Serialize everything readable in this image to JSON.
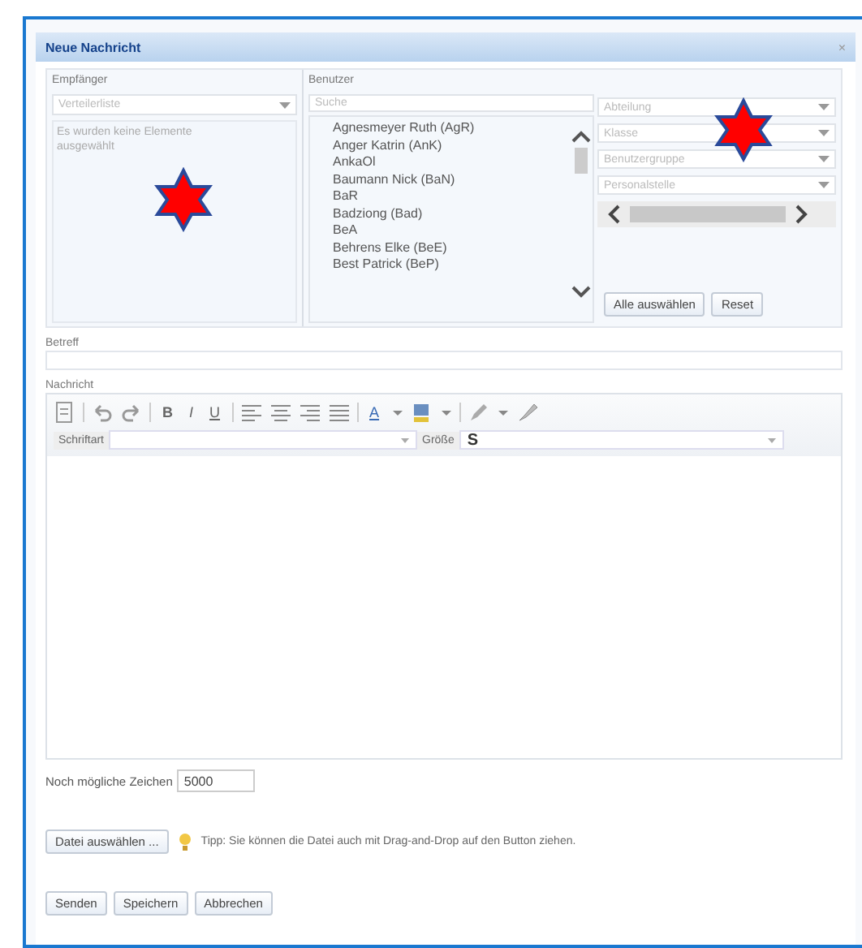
{
  "dialog": {
    "title": "Neue Nachricht",
    "close": "×"
  },
  "recipients": {
    "label": "Empfänger",
    "list_placeholder": "Verteilerliste",
    "empty_text": "Es wurden keine Elemente ausgewählt"
  },
  "users": {
    "label": "Benutzer",
    "search_placeholder": "Suche",
    "items": [
      "Agnesmeyer Ruth (AgR)",
      "Anger Katrin (AnK)",
      "AnkaOl",
      "Baumann Nick (BaN)",
      "BaR",
      "Badziong (Bad)",
      "BeA",
      "Behrens Elke (BeE)",
      "Best Patrick (BeP)"
    ],
    "filters": [
      "Abteilung",
      "Klasse",
      "Benutzergruppe",
      "Personalstelle"
    ],
    "buttons": [
      "Alle auswählen",
      "Reset"
    ]
  },
  "subject": {
    "label": "Betreff"
  },
  "message": {
    "label": "Nachricht",
    "toolbar": [
      {
        "kind": "icon"
      },
      {
        "kind": "sep"
      },
      {
        "kind": "icon"
      },
      {
        "kind": "icon"
      },
      {
        "kind": "sep"
      },
      {
        "kind": "text",
        "text": "B"
      },
      {
        "kind": "text",
        "text": "I"
      },
      {
        "kind": "text",
        "text": "U"
      },
      {
        "kind": "sep"
      },
      {
        "kind": "icon"
      },
      {
        "kind": "icon"
      },
      {
        "kind": "icon"
      },
      {
        "kind": "icon"
      },
      {
        "kind": "sep"
      },
      {
        "kind": "text",
        "text": "A"
      },
      {
        "kind": "icon"
      },
      {
        "kind": "icon"
      },
      {
        "kind": "icon"
      },
      {
        "kind": "sep"
      },
      {
        "kind": "icon"
      },
      {
        "kind": "icon"
      },
      {
        "kind": "icon"
      }
    ],
    "font_label": "Schriftart",
    "size_label": "Größe",
    "size_value": "S"
  },
  "remaining": {
    "label": "Noch mögliche Zeichen",
    "value": "5000"
  },
  "attach": {
    "button": "Datei auswählen ...",
    "tip": "Tipp: Sie können die Datei auch mit Drag-and-Drop auf den Button ziehen."
  },
  "actions": [
    "Senden",
    "Speichern",
    "Abbrechen"
  ]
}
